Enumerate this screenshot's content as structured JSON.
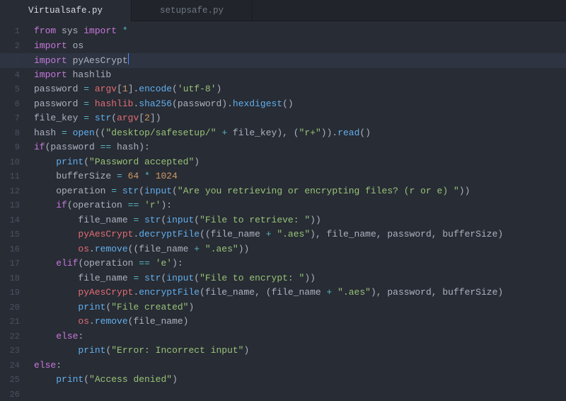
{
  "tabs": {
    "active": "Virtualsafe.py",
    "inactive": "setupsafe.py"
  },
  "cursor_line": 3,
  "code_lines": [
    [
      [
        "kw",
        "from"
      ],
      [
        "pln",
        " "
      ],
      [
        "pln",
        "sys"
      ],
      [
        "pln",
        " "
      ],
      [
        "kw",
        "import"
      ],
      [
        "pln",
        " "
      ],
      [
        "op",
        "*"
      ]
    ],
    [
      [
        "kw",
        "import"
      ],
      [
        "pln",
        " "
      ],
      [
        "pln",
        "os"
      ]
    ],
    [
      [
        "kw",
        "import"
      ],
      [
        "pln",
        " "
      ],
      [
        "pln",
        "pyAesCrypt"
      ]
    ],
    [
      [
        "kw",
        "import"
      ],
      [
        "pln",
        " "
      ],
      [
        "pln",
        "hashlib"
      ]
    ],
    [
      [
        "pln",
        "password "
      ],
      [
        "op",
        "="
      ],
      [
        "pln",
        " "
      ],
      [
        "var",
        "argv"
      ],
      [
        "pln",
        "["
      ],
      [
        "num",
        "1"
      ],
      [
        "pln",
        "]."
      ],
      [
        "fn",
        "encode"
      ],
      [
        "pln",
        "("
      ],
      [
        "str",
        "'utf-8'"
      ],
      [
        "pln",
        ")"
      ]
    ],
    [
      [
        "pln",
        "password "
      ],
      [
        "op",
        "="
      ],
      [
        "pln",
        " "
      ],
      [
        "var",
        "hashlib"
      ],
      [
        "pln",
        "."
      ],
      [
        "fn",
        "sha256"
      ],
      [
        "pln",
        "(password)."
      ],
      [
        "fn",
        "hexdigest"
      ],
      [
        "pln",
        "()"
      ]
    ],
    [
      [
        "pln",
        "file_key "
      ],
      [
        "op",
        "="
      ],
      [
        "pln",
        " "
      ],
      [
        "fn",
        "str"
      ],
      [
        "pln",
        "("
      ],
      [
        "var",
        "argv"
      ],
      [
        "pln",
        "["
      ],
      [
        "num",
        "2"
      ],
      [
        "pln",
        "])"
      ]
    ],
    [
      [
        "pln",
        "hash "
      ],
      [
        "op",
        "="
      ],
      [
        "pln",
        " "
      ],
      [
        "fn",
        "open"
      ],
      [
        "pln",
        "(("
      ],
      [
        "str",
        "\"desktop/safesetup/\""
      ],
      [
        "pln",
        " "
      ],
      [
        "op",
        "+"
      ],
      [
        "pln",
        " file_key), ("
      ],
      [
        "str",
        "\"r+\""
      ],
      [
        "pln",
        "))."
      ],
      [
        "fn",
        "read"
      ],
      [
        "pln",
        "()"
      ]
    ],
    [
      [
        "kw",
        "if"
      ],
      [
        "pln",
        "(password "
      ],
      [
        "op",
        "=="
      ],
      [
        "pln",
        " hash):"
      ]
    ],
    [
      [
        "pln",
        "    "
      ],
      [
        "fn",
        "print"
      ],
      [
        "pln",
        "("
      ],
      [
        "str",
        "\"Password accepted\""
      ],
      [
        "pln",
        ")"
      ]
    ],
    [
      [
        "pln",
        "    bufferSize "
      ],
      [
        "op",
        "="
      ],
      [
        "pln",
        " "
      ],
      [
        "num",
        "64"
      ],
      [
        "pln",
        " "
      ],
      [
        "op",
        "*"
      ],
      [
        "pln",
        " "
      ],
      [
        "num",
        "1024"
      ]
    ],
    [
      [
        "pln",
        "    operation "
      ],
      [
        "op",
        "="
      ],
      [
        "pln",
        " "
      ],
      [
        "fn",
        "str"
      ],
      [
        "pln",
        "("
      ],
      [
        "fn",
        "input"
      ],
      [
        "pln",
        "("
      ],
      [
        "str",
        "\"Are you retrieving or encrypting files? (r or e) \""
      ],
      [
        "pln",
        "))"
      ]
    ],
    [
      [
        "pln",
        "    "
      ],
      [
        "kw",
        "if"
      ],
      [
        "pln",
        "(operation "
      ],
      [
        "op",
        "=="
      ],
      [
        "pln",
        " "
      ],
      [
        "str",
        "'r'"
      ],
      [
        "pln",
        "):"
      ]
    ],
    [
      [
        "pln",
        "        file_name "
      ],
      [
        "op",
        "="
      ],
      [
        "pln",
        " "
      ],
      [
        "fn",
        "str"
      ],
      [
        "pln",
        "("
      ],
      [
        "fn",
        "input"
      ],
      [
        "pln",
        "("
      ],
      [
        "str",
        "\"File to retrieve: \""
      ],
      [
        "pln",
        "))"
      ]
    ],
    [
      [
        "pln",
        "        "
      ],
      [
        "var",
        "pyAesCrypt"
      ],
      [
        "pln",
        "."
      ],
      [
        "fn",
        "decryptFile"
      ],
      [
        "pln",
        "((file_name "
      ],
      [
        "op",
        "+"
      ],
      [
        "pln",
        " "
      ],
      [
        "str",
        "\".aes\""
      ],
      [
        "pln",
        "), file_name, password, bufferSize)"
      ]
    ],
    [
      [
        "pln",
        "        "
      ],
      [
        "var",
        "os"
      ],
      [
        "pln",
        "."
      ],
      [
        "fn",
        "remove"
      ],
      [
        "pln",
        "((file_name "
      ],
      [
        "op",
        "+"
      ],
      [
        "pln",
        " "
      ],
      [
        "str",
        "\".aes\""
      ],
      [
        "pln",
        "))"
      ]
    ],
    [
      [
        "pln",
        "    "
      ],
      [
        "kw",
        "elif"
      ],
      [
        "pln",
        "(operation "
      ],
      [
        "op",
        "=="
      ],
      [
        "pln",
        " "
      ],
      [
        "str",
        "'e'"
      ],
      [
        "pln",
        "):"
      ]
    ],
    [
      [
        "pln",
        "        file_name "
      ],
      [
        "op",
        "="
      ],
      [
        "pln",
        " "
      ],
      [
        "fn",
        "str"
      ],
      [
        "pln",
        "("
      ],
      [
        "fn",
        "input"
      ],
      [
        "pln",
        "("
      ],
      [
        "str",
        "\"File to encrypt: \""
      ],
      [
        "pln",
        "))"
      ]
    ],
    [
      [
        "pln",
        "        "
      ],
      [
        "var",
        "pyAesCrypt"
      ],
      [
        "pln",
        "."
      ],
      [
        "fn",
        "encryptFile"
      ],
      [
        "pln",
        "(file_name, (file_name "
      ],
      [
        "op",
        "+"
      ],
      [
        "pln",
        " "
      ],
      [
        "str",
        "\".aes\""
      ],
      [
        "pln",
        "), password, bufferSize)"
      ]
    ],
    [
      [
        "pln",
        "        "
      ],
      [
        "fn",
        "print"
      ],
      [
        "pln",
        "("
      ],
      [
        "str",
        "\"File created\""
      ],
      [
        "pln",
        ")"
      ]
    ],
    [
      [
        "pln",
        "        "
      ],
      [
        "var",
        "os"
      ],
      [
        "pln",
        "."
      ],
      [
        "fn",
        "remove"
      ],
      [
        "pln",
        "(file_name)"
      ]
    ],
    [
      [
        "pln",
        "    "
      ],
      [
        "kw",
        "else"
      ],
      [
        "pln",
        ":"
      ]
    ],
    [
      [
        "pln",
        "        "
      ],
      [
        "fn",
        "print"
      ],
      [
        "pln",
        "("
      ],
      [
        "str",
        "\"Error: Incorrect input\""
      ],
      [
        "pln",
        ")"
      ]
    ],
    [
      [
        "kw",
        "else"
      ],
      [
        "pln",
        ":"
      ]
    ],
    [
      [
        "pln",
        "    "
      ],
      [
        "fn",
        "print"
      ],
      [
        "pln",
        "("
      ],
      [
        "str",
        "\"Access denied\""
      ],
      [
        "pln",
        ")"
      ]
    ],
    []
  ]
}
